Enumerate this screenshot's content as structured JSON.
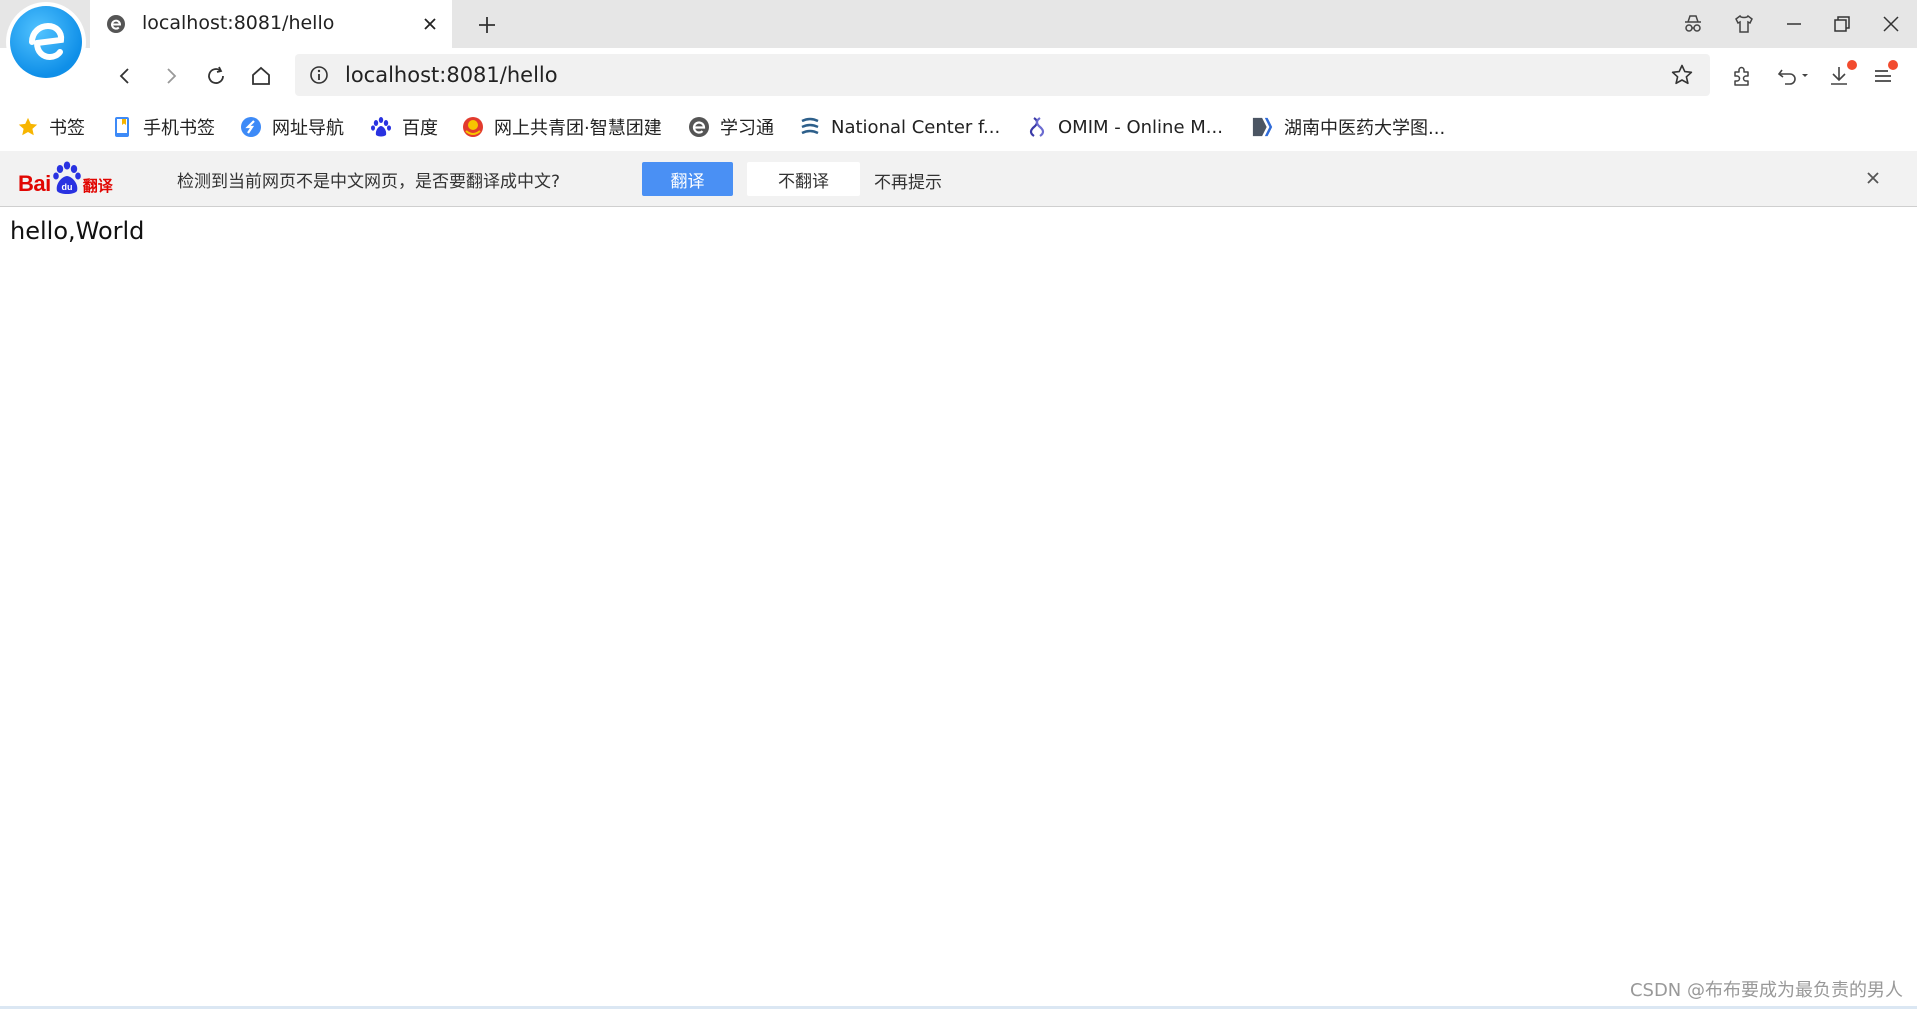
{
  "tab": {
    "title": "localhost:8081/hello"
  },
  "address_bar": {
    "url": "localhost:8081/hello"
  },
  "bookmarks": [
    {
      "label": "书签",
      "icon": "star-icon"
    },
    {
      "label": "手机书签",
      "icon": "phone-bookmark-icon"
    },
    {
      "label": "网址导航",
      "icon": "navigation-icon"
    },
    {
      "label": "百度",
      "icon": "baidu-paw-icon"
    },
    {
      "label": "网上共青团·智慧团建",
      "icon": "youth-league-icon"
    },
    {
      "label": "学习通",
      "icon": "xuexitong-icon"
    },
    {
      "label": "National Center f...",
      "icon": "ncbi-icon"
    },
    {
      "label": "OMIM - Online M...",
      "icon": "omim-icon"
    },
    {
      "label": "湖南中医药大学图...",
      "icon": "library-icon"
    }
  ],
  "translate_bar": {
    "logo_text": "Bai",
    "logo_suffix": "翻译",
    "message": "检测到当前网页不是中文网页，是否要翻译成中文?",
    "translate_label": "翻译",
    "no_translate_label": "不翻译",
    "no_prompt_label": "不再提示"
  },
  "page": {
    "content": "hello,World"
  },
  "watermark": "CSDN @布布要成为最负责的男人",
  "colors": {
    "accent_blue": "#4a90f4",
    "baidu_red": "#e10602",
    "notification_dot": "#f24b2e",
    "logo_blue": "#0f8fe8"
  }
}
